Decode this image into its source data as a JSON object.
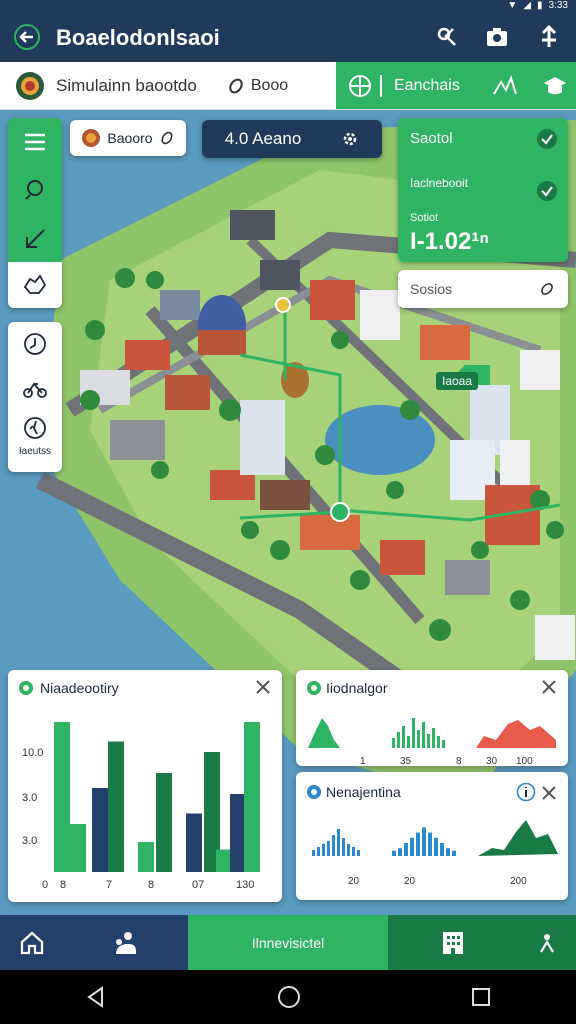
{
  "status": {
    "time": "3:33"
  },
  "appbar": {
    "title": "Boaelodonlsaoi"
  },
  "subbar": {
    "location_label": "Simulainn baootdo",
    "search_label": "Booo",
    "tab_label": "Eanchais"
  },
  "toolbar": {
    "filter_chip": "Baooro",
    "info_chip": "4.0 Aeano"
  },
  "side_legend": {
    "label": "Iaeutss"
  },
  "sensor_panel": {
    "title": "Saotol",
    "row_label": "Iaclnebooit",
    "row_caption": "Sotiot",
    "value": "1.02·ⁿ⁰",
    "value_display": "I‑1.02¹ⁿ"
  },
  "search_box": {
    "placeholder": "Sosios"
  },
  "map_label": {
    "text": "Iaoaa"
  },
  "card_main": {
    "title": "Niaadeootiry",
    "y_ticks": [
      "10.0",
      "3.0",
      "3.0",
      "0"
    ],
    "x_ticks": [
      "8",
      "7",
      "8",
      "07",
      "130"
    ],
    "colors": {
      "green": "#2fb463",
      "dark_green": "#1a7a45",
      "navy": "#24416b"
    }
  },
  "card_top_right": {
    "title": "Iiodnalgor",
    "x_ticks": [
      "1",
      "35",
      "8",
      "30",
      "100"
    ]
  },
  "card_bottom_right": {
    "title": "Nenajentina",
    "x_ticks": [
      "20",
      "20",
      "200"
    ]
  },
  "bottom_nav": {
    "center_label": "Ilnnevisictel"
  },
  "chart_data": [
    {
      "type": "bar",
      "title": "Niaadeootiry",
      "categories": [
        "8",
        "7",
        "8",
        "07",
        "130"
      ],
      "series": [
        {
          "values": [
            10,
            3.2,
            5.6,
            8.7,
            2.0,
            6.6,
            3.9,
            8.0,
            1.5,
            5.2,
            10
          ]
        }
      ],
      "ylim": [
        0,
        10
      ]
    },
    {
      "type": "bar",
      "title": "Iiodnalgor",
      "categories": [
        "1",
        "35",
        "8",
        "30",
        "100"
      ]
    },
    {
      "type": "bar",
      "title": "Nenajentina",
      "categories": [
        "20",
        "20",
        "200"
      ]
    }
  ]
}
